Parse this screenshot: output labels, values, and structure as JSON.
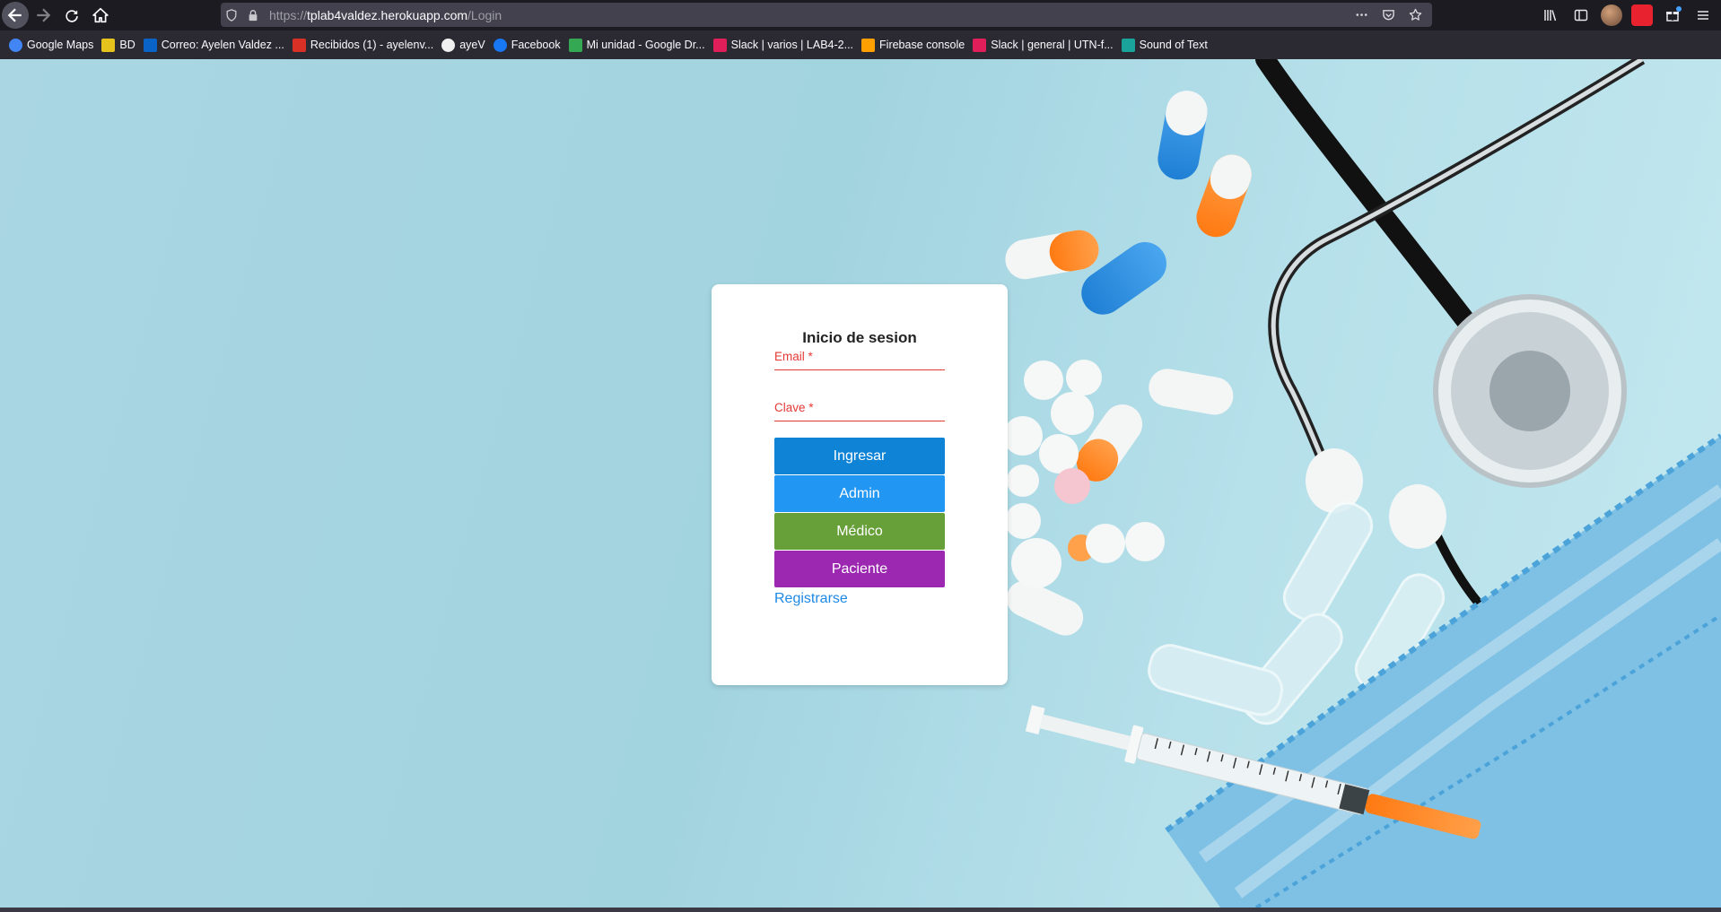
{
  "browser": {
    "url_prefix": "https://",
    "url_host": "tplab4valdez.herokuapp.com",
    "url_path": "/Login"
  },
  "bookmarks": [
    {
      "label": "Google Maps",
      "icon": "google-icon",
      "color": "#4285f4"
    },
    {
      "label": "BD",
      "icon": "image-icon",
      "color": "#e6c21c"
    },
    {
      "label": "Correo: Ayelen Valdez ...",
      "icon": "outlook-icon",
      "color": "#0a64c8"
    },
    {
      "label": "Recibidos (1) - ayelenv...",
      "icon": "gmail-icon",
      "color": "#d93025"
    },
    {
      "label": "ayeV",
      "icon": "github-icon",
      "color": "#f0f0f0"
    },
    {
      "label": "Facebook",
      "icon": "facebook-icon",
      "color": "#1877f2"
    },
    {
      "label": "Mi unidad - Google Dr...",
      "icon": "drive-icon",
      "color": "#34a853"
    },
    {
      "label": "Slack | varios | LAB4-2...",
      "icon": "slack-icon",
      "color": "#e01e5a"
    },
    {
      "label": "Firebase console",
      "icon": "firebase-icon",
      "color": "#ffa000"
    },
    {
      "label": "Slack | general | UTN-f...",
      "icon": "slack-icon",
      "color": "#e01e5a"
    },
    {
      "label": "Sound of Text",
      "icon": "sound-icon",
      "color": "#1aa39a"
    }
  ],
  "login": {
    "title": "Inicio de sesion",
    "email_label": "Email *",
    "password_label": "Clave *",
    "buttons": {
      "ingresar": {
        "label": "Ingresar",
        "color": "#0f84d6"
      },
      "admin": {
        "label": "Admin",
        "color": "#2196f3"
      },
      "medico": {
        "label": "Médico",
        "color": "#679f38"
      },
      "paciente": {
        "label": "Paciente",
        "color": "#9c27b0"
      }
    },
    "register_link": "Registrarse"
  }
}
